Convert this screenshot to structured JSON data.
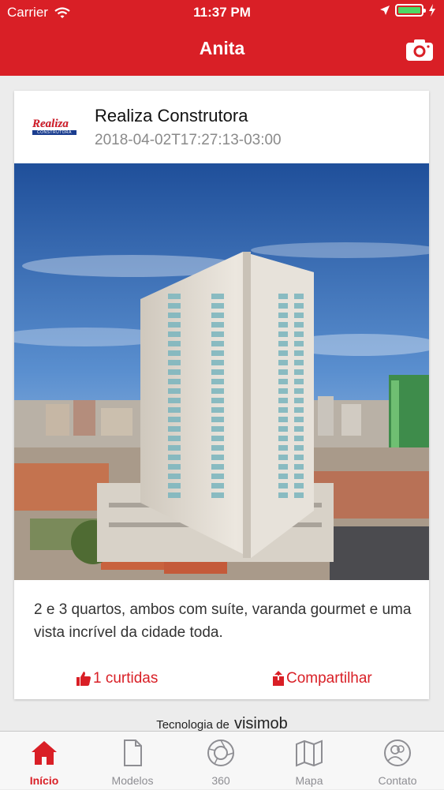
{
  "status_bar": {
    "carrier": "Carrier",
    "time": "11:37 PM",
    "battery_percent": 100
  },
  "nav": {
    "title": "Anita",
    "camera_icon": "camera-icon"
  },
  "post": {
    "company_logo": {
      "line1": "Realiza",
      "line2": "CONSTRUTORA"
    },
    "author": "Realiza Construtora",
    "date": "2018-04-02T17:27:13-03:00",
    "description": "2 e 3 quartos, ambos com suíte, varanda gourmet e uma vista incrível da cidade toda.",
    "like_label": "1 curtidas",
    "share_label": "Compartilhar"
  },
  "credit": {
    "prefix": "Tecnologia de",
    "brand": "visimob"
  },
  "tabs": [
    {
      "label": "Início",
      "icon": "home-icon",
      "active": true
    },
    {
      "label": "Modelos",
      "icon": "document-icon",
      "active": false
    },
    {
      "label": "360",
      "icon": "camera-lens-icon",
      "active": false
    },
    {
      "label": "Mapa",
      "icon": "map-icon",
      "active": false
    },
    {
      "label": "Contato",
      "icon": "contacts-icon",
      "active": false
    }
  ],
  "colors": {
    "accent": "#d91f26",
    "tab_inactive": "#8e8e93",
    "background": "#ececec"
  }
}
